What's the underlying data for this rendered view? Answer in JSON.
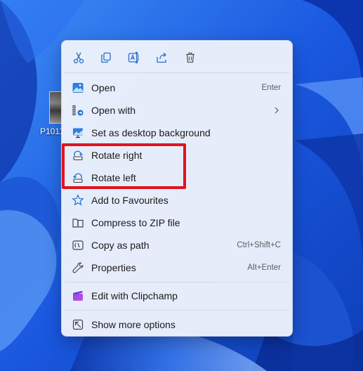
{
  "desktop": {
    "icon_label": "P1011"
  },
  "toolbar": {
    "items": [
      {
        "name": "Cut",
        "icon": "scissors-icon"
      },
      {
        "name": "Copy",
        "icon": "copy-icon"
      },
      {
        "name": "Rename",
        "icon": "rename-icon"
      },
      {
        "name": "Share",
        "icon": "share-icon"
      },
      {
        "name": "Delete",
        "icon": "trash-icon"
      }
    ]
  },
  "menu": {
    "items": [
      {
        "label": "Open",
        "shortcut": "Enter",
        "icon": "image-icon"
      },
      {
        "label": "Open with",
        "shortcut": "",
        "icon": "open-with-icon"
      },
      {
        "label": "Set as desktop background",
        "shortcut": "",
        "icon": "desktop-background-icon"
      },
      {
        "label": "Rotate right",
        "shortcut": "",
        "icon": "rotate-right-icon"
      },
      {
        "label": "Rotate left",
        "shortcut": "",
        "icon": "rotate-left-icon"
      },
      {
        "label": "Add to Favourites",
        "shortcut": "",
        "icon": "star-icon"
      },
      {
        "label": "Compress to ZIP file",
        "shortcut": "",
        "icon": "zip-icon"
      },
      {
        "label": "Copy as path",
        "shortcut": "Ctrl+Shift+C",
        "icon": "copy-path-icon"
      },
      {
        "label": "Properties",
        "shortcut": "Alt+Enter",
        "icon": "wrench-icon"
      },
      {
        "label": "Edit with Clipchamp",
        "shortcut": "",
        "icon": "clipchamp-icon"
      },
      {
        "label": "Show more options",
        "shortcut": "",
        "icon": "show-more-icon"
      }
    ]
  },
  "colors": {
    "accent": "#0067c0",
    "highlight_box": "#e0141e",
    "desktop": "#1d5fe0"
  }
}
